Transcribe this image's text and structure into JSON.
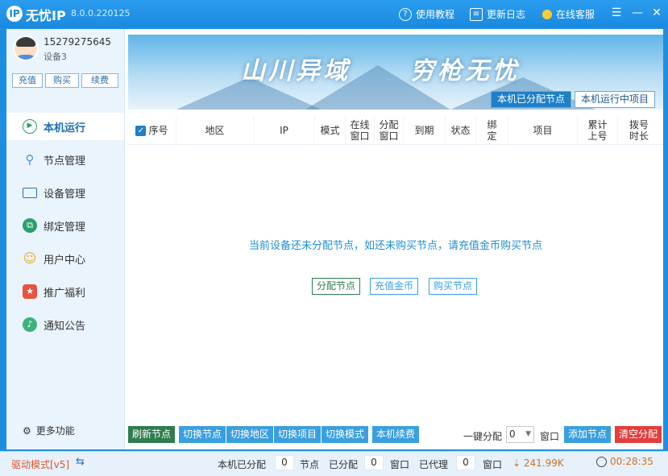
{
  "window": {
    "title": "无忧IP",
    "version": "8.0.0.220125",
    "logo_char": "IP",
    "links": {
      "tutorial": "使用教程",
      "changelog": "更新日志",
      "support": "在线客服"
    }
  },
  "user": {
    "phone": "15279275645",
    "device": "设备3",
    "buttons": {
      "recharge": "充值",
      "buy": "购买",
      "renew": "续费"
    }
  },
  "sidebar": {
    "items": [
      {
        "label": "本机运行",
        "icon": "play-circle-icon",
        "active": true
      },
      {
        "label": "节点管理",
        "icon": "node-tree-icon"
      },
      {
        "label": "设备管理",
        "icon": "laptop-icon"
      },
      {
        "label": "绑定管理",
        "icon": "bind-icon"
      },
      {
        "label": "用户中心",
        "icon": "user-icon"
      },
      {
        "label": "推广福利",
        "icon": "gift-icon"
      },
      {
        "label": "通知公告",
        "icon": "bell-icon"
      }
    ],
    "more": "更多功能"
  },
  "banner": {
    "text_left": "山川异域",
    "text_right": "穷枪无忧",
    "tabs": [
      "本机已分配节点",
      "本机运行中项目"
    ]
  },
  "table": {
    "columns": [
      "序号",
      "地区",
      "IP",
      "模式",
      "在线\n窗口",
      "分配\n窗口",
      "到期",
      "状态",
      "绑\n定",
      "项目",
      "累计\n上号",
      "拨号\n时长"
    ]
  },
  "empty": {
    "message": "当前设备还未分配节点，如还未购买节点，请充值金币购买节点",
    "buttons": [
      "分配节点",
      "充值金币",
      "购买节点"
    ]
  },
  "bottom": {
    "buttons": [
      "刷新节点",
      "切换节点",
      "切换地区",
      "切换项目",
      "切换模式",
      "本机续费"
    ],
    "onekey_label": "一键分配",
    "onekey_value": "0",
    "onekey_unit": "窗口",
    "add_node": "添加节点",
    "clear_alloc": "清空分配"
  },
  "status": {
    "drive_mode": "驱动模式[v5]",
    "allocated_label": "本机已分配",
    "allocated_nodes": "0",
    "nodes_unit": "节点",
    "assigned_label": "已分配",
    "assigned_windows": "0",
    "window_unit1": "窗口",
    "proxy_label": "已代理",
    "proxy_windows": "0",
    "window_unit2": "窗口",
    "speed": "241.99K",
    "timer": "00:28:35"
  },
  "colors": {
    "accent": "#1f7fc8",
    "titlebar": "#1a8ae0",
    "danger": "#e43d3d",
    "success": "#2e7d4f"
  }
}
